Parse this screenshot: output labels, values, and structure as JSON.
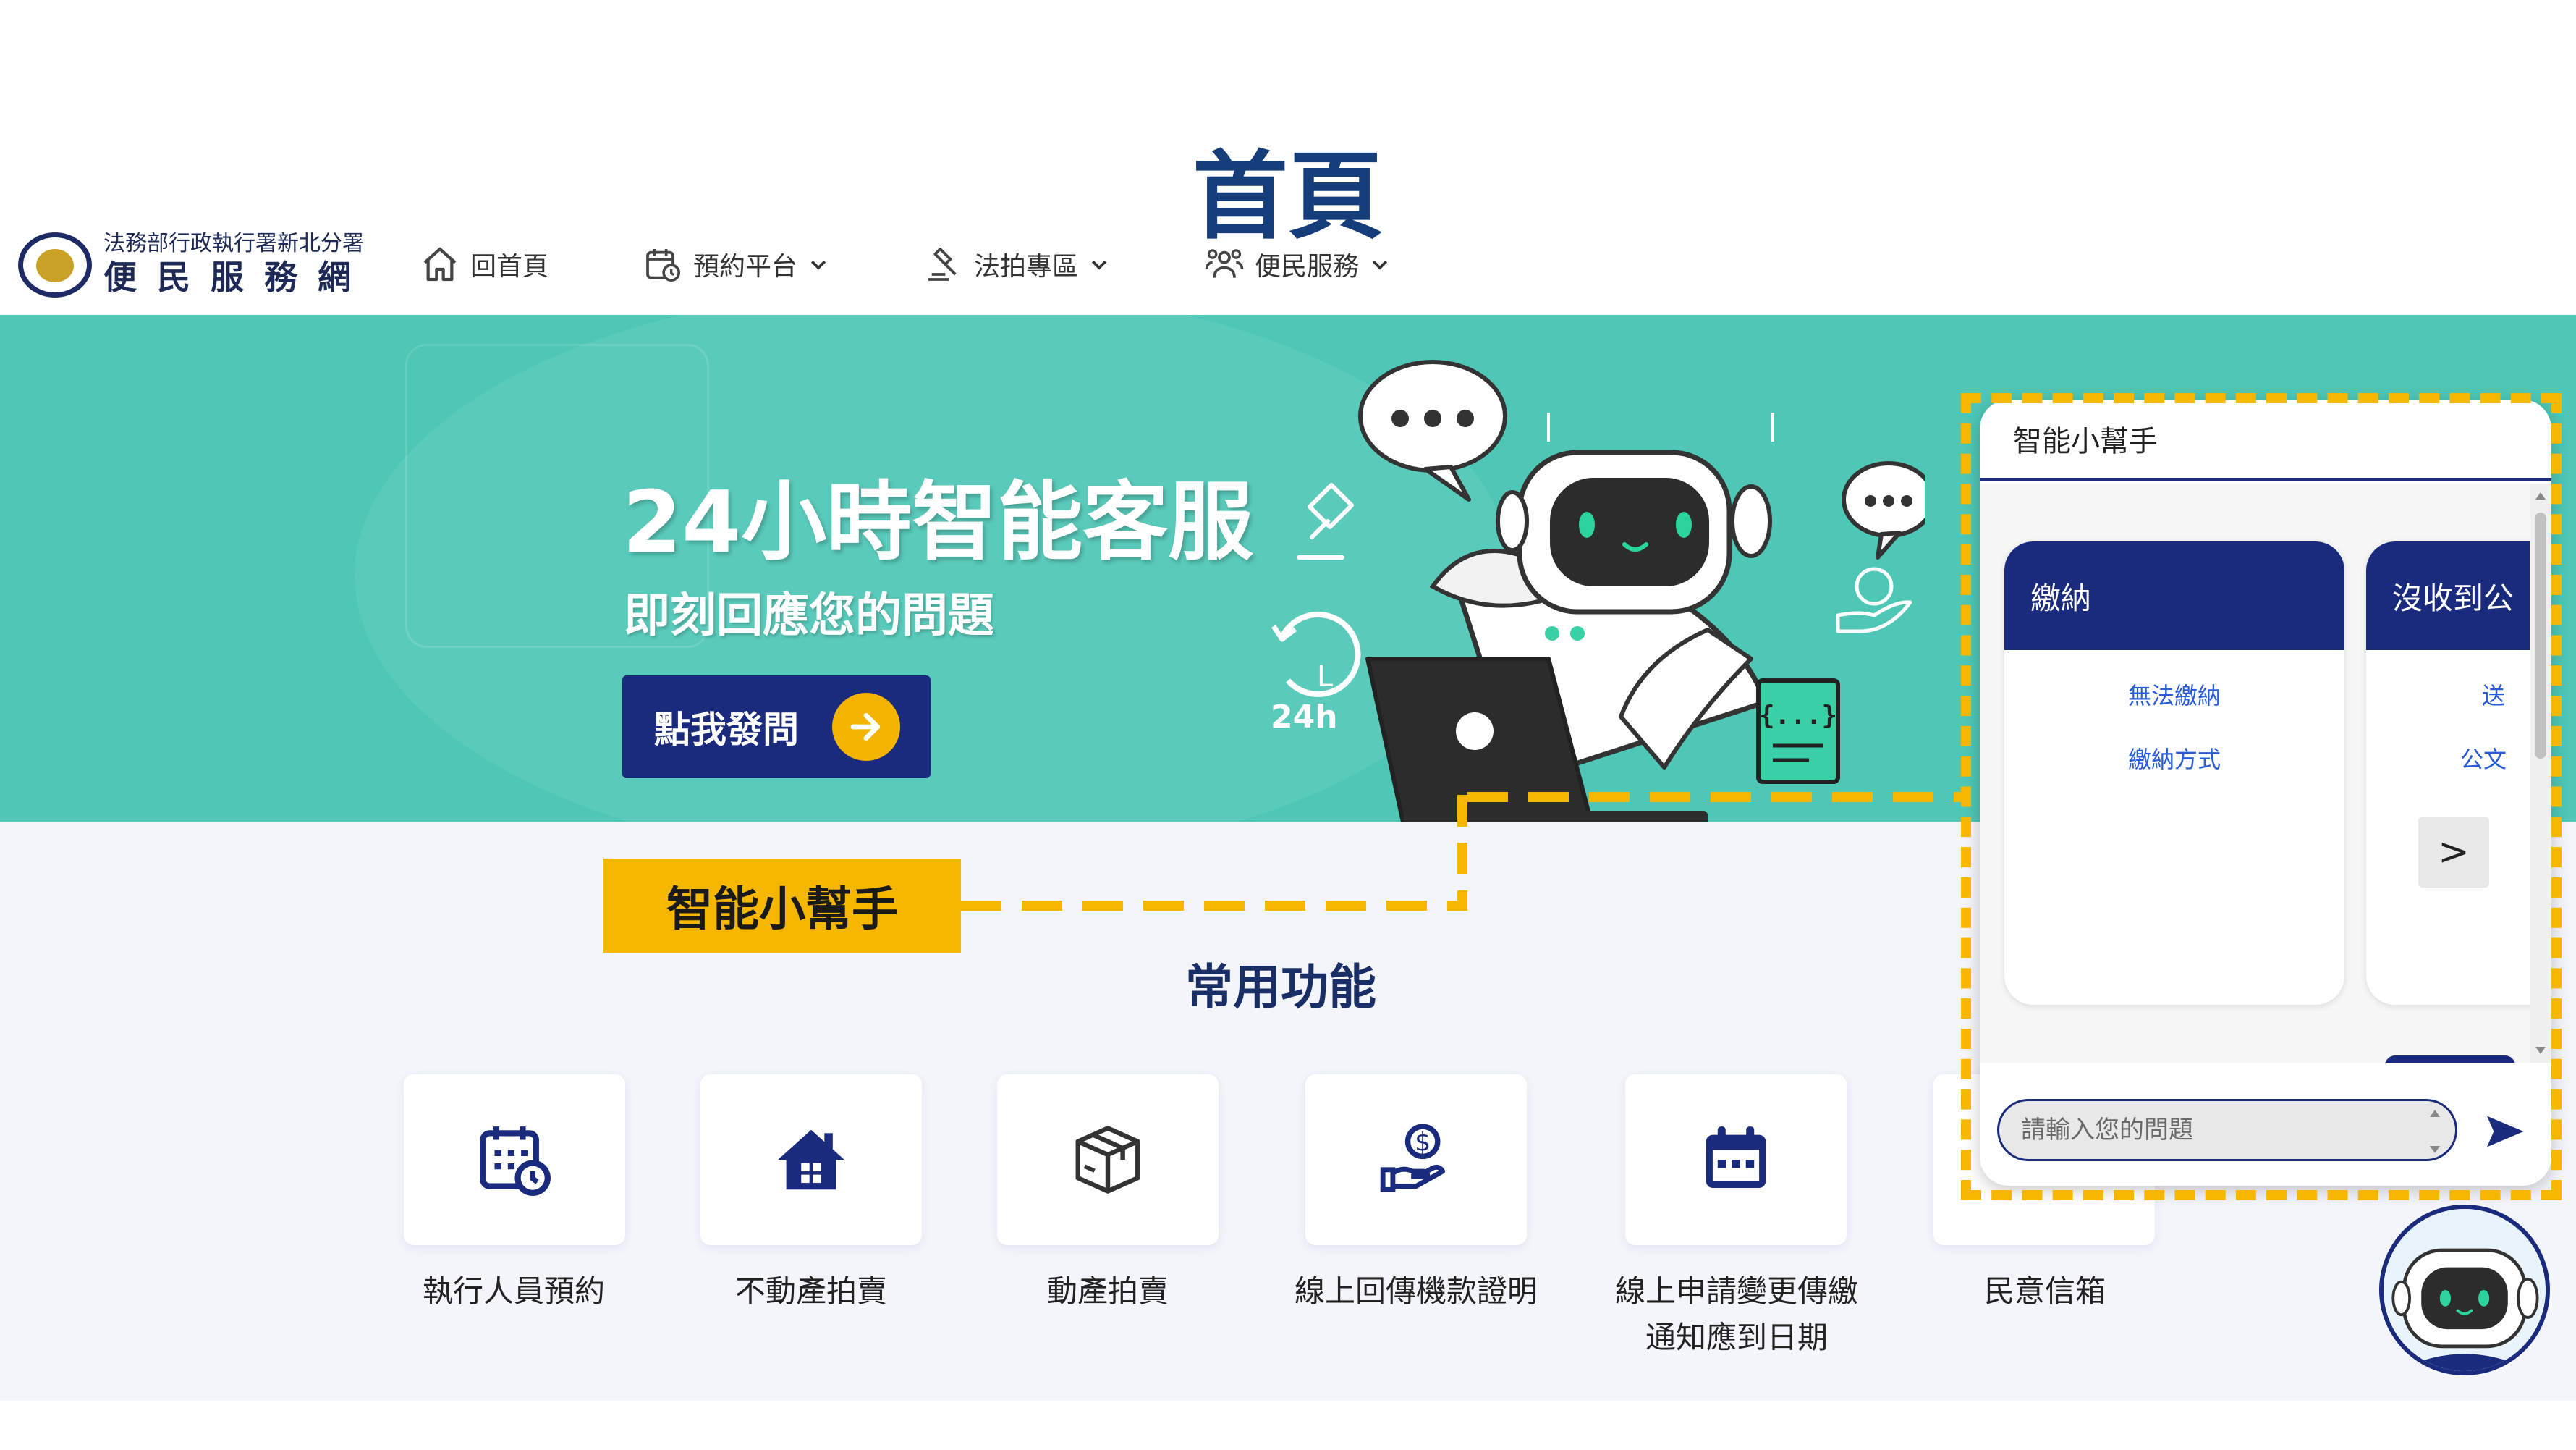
{
  "slide": {
    "title": "首頁"
  },
  "header": {
    "logo": {
      "subtitle": "法務部行政執行署新北分署",
      "name": "便民服務網"
    },
    "nav": [
      {
        "label": "回首頁",
        "icon": "home-icon",
        "has_dropdown": false
      },
      {
        "label": "預約平台",
        "icon": "calendar-clock-icon",
        "has_dropdown": true
      },
      {
        "label": "法拍專區",
        "icon": "gavel-icon",
        "has_dropdown": true
      },
      {
        "label": "便民服務",
        "icon": "people-icon",
        "has_dropdown": true
      }
    ]
  },
  "banner": {
    "title": "24小時智能客服",
    "subtitle": "即刻回應您的問題",
    "cta_label": "點我發問",
    "illustration_text": {
      "badge": "24h",
      "clock_letter": "L",
      "code": "{...}"
    }
  },
  "callout": {
    "label": "智能小幫手"
  },
  "features": {
    "title": "常用功能",
    "items": [
      {
        "label": "執行人員預約",
        "icon": "calendar-clock-icon"
      },
      {
        "label": "不動產拍賣",
        "icon": "house-icon"
      },
      {
        "label": "動產拍賣",
        "icon": "box-icon"
      },
      {
        "label": "線上回傳機款證明",
        "icon": "hand-coin-icon"
      },
      {
        "label": "線上申請變更傳繳通知應到日期",
        "icon": "calendar-icon"
      },
      {
        "label": "民意信箱",
        "icon": "mailbox-icon"
      }
    ]
  },
  "chat": {
    "title": "智能小幫手",
    "cards": [
      {
        "title": "繳納",
        "links": [
          "無法繳納",
          "繳納方式"
        ]
      },
      {
        "title": "沒收到公",
        "links": [
          "送",
          "公文"
        ]
      }
    ],
    "next_label": ">",
    "input_placeholder": "請輸入您的問題"
  },
  "colors": {
    "navy": "#1a2a7c",
    "teal": "#4ec7b6",
    "highlight": "#f5b700",
    "accent_yellow": "#f4b400"
  }
}
